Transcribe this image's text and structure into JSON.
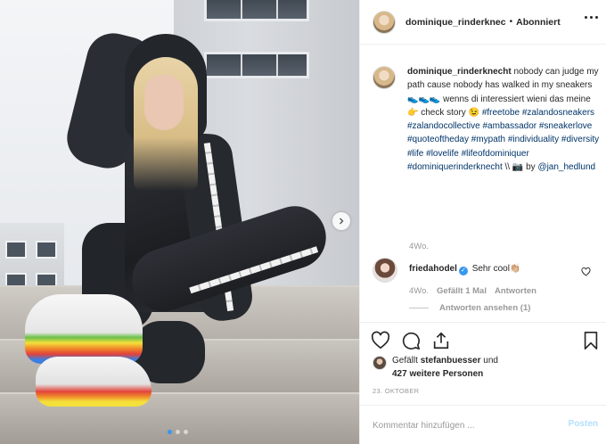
{
  "post": {
    "username": "dominique_rinderknec",
    "separator": "•",
    "follow_state": "Abonniert"
  },
  "caption": {
    "username": "dominique_rinderknecht",
    "text_1": " nobody can judge my path cause nobody has walked in my sneakers ",
    "emoji_1": "👟👟👟",
    "text_2": " wenns di interessiert wieni das meine ",
    "emoji_2": "👉",
    "text_3": " check story ",
    "emoji_3": "😉",
    "hashtags": [
      "#freetobe",
      "#zalandosneakers",
      "#zalandocollective",
      "#ambassador",
      "#sneakerlove",
      "#quoteoftheday",
      "#mypath",
      "#individuality",
      "#diversity",
      "#life",
      "#lovelife",
      "#lifeofdominiquer",
      "#dominiquerinderknecht"
    ],
    "text_4": " \\\\ ",
    "emoji_4": "📷",
    "text_5": " by ",
    "credit": "@jan_hedlund",
    "time": "4Wo."
  },
  "comment": {
    "username": "friedahodel",
    "verified_mark": "✓",
    "text": "Sehr cool👏🏼",
    "time": "4Wo.",
    "likes": "Gefällt 1 Mal",
    "reply": "Antworten",
    "view_replies": "Antworten ansehen (1)"
  },
  "likes": {
    "prefix": "Gefällt ",
    "user": "stefanbuesser",
    "middle": " und",
    "others": "427 weitere Personen"
  },
  "date": "23. OKTOBER",
  "composer": {
    "placeholder": "Kommentar hinzufügen ...",
    "post_label": "Posten"
  },
  "icons": {
    "heart": "heart-icon",
    "comment": "comment-icon",
    "share": "share-icon",
    "save": "bookmark-icon",
    "more": "more-options-icon",
    "next": "chevron-right-icon"
  },
  "colors": {
    "link": "#003569",
    "verified": "#3897f0",
    "muted": "#999999",
    "post_disabled": "#b2dffc"
  }
}
